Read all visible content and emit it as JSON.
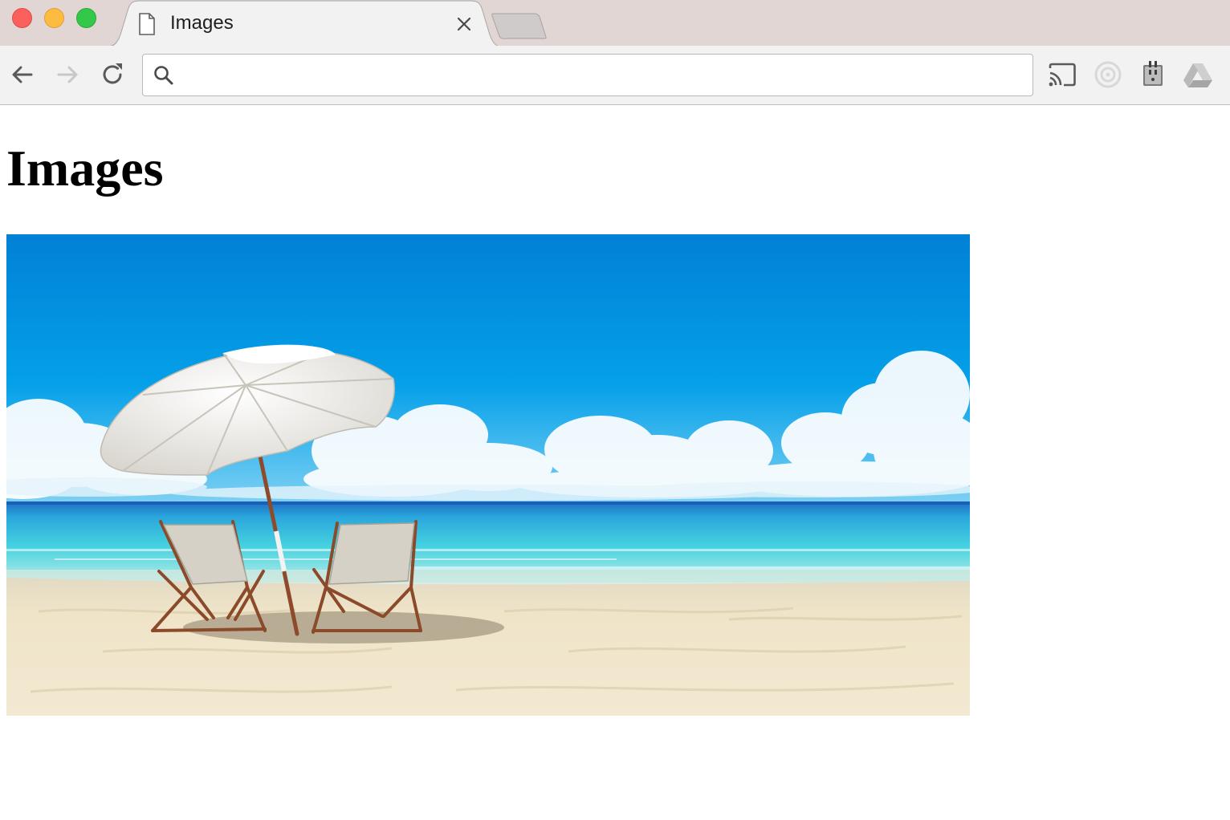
{
  "window": {
    "controls": [
      "close",
      "minimize",
      "maximize"
    ]
  },
  "tabs": [
    {
      "title": "Images",
      "icon": "document-icon",
      "active": true
    }
  ],
  "toolbar": {
    "omnibox_value": "",
    "extensions": [
      "cast-icon",
      "circle-extension-icon",
      "plug-extension-icon",
      "google-drive-icon"
    ]
  },
  "page": {
    "heading": "Images",
    "image": {
      "subject": "beach-umbrella-chairs"
    }
  },
  "colors": {
    "tabstrip": "#e2d6d4",
    "toolbar": "#f2f2f2",
    "sky_top": "#0181d6",
    "sea": "#3ccfe0",
    "sand": "#efe4c8"
  }
}
